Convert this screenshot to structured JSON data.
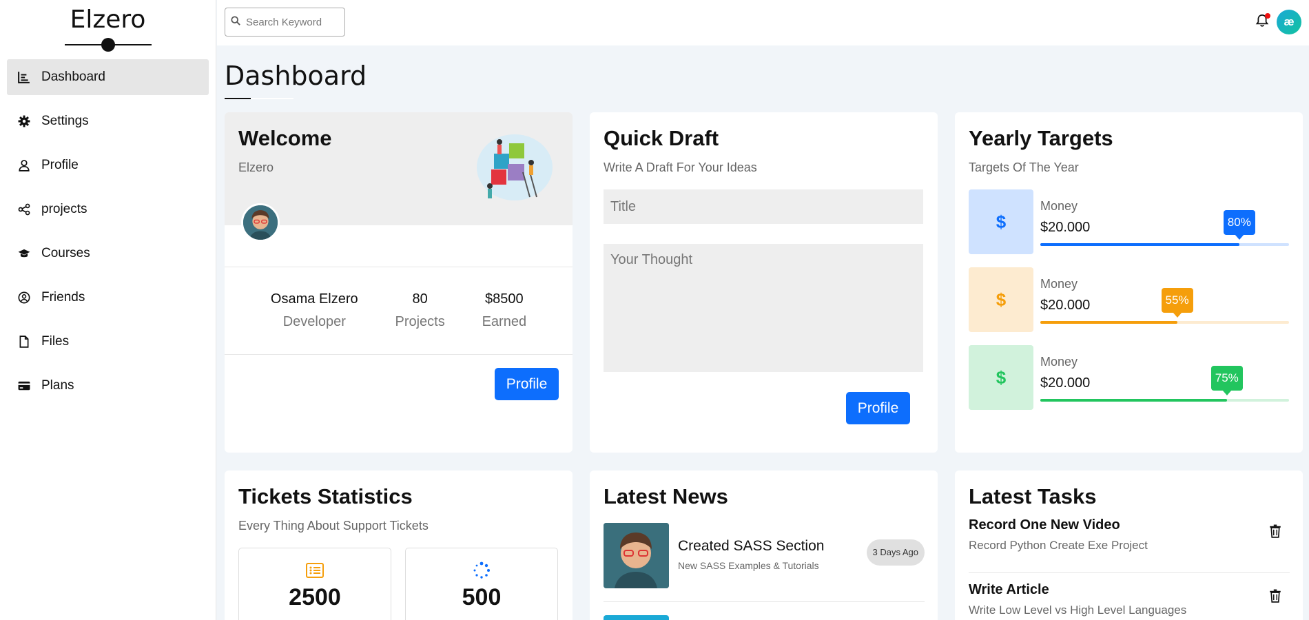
{
  "brand": {
    "title": "Elzero"
  },
  "sidebar": {
    "items": [
      {
        "label": "Dashboard",
        "icon": "chart-icon"
      },
      {
        "label": "Settings",
        "icon": "gear-icon"
      },
      {
        "label": "Profile",
        "icon": "user-icon"
      },
      {
        "label": "projects",
        "icon": "share-icon"
      },
      {
        "label": "Courses",
        "icon": "graduation-cap-icon"
      },
      {
        "label": "Friends",
        "icon": "user-circle-icon"
      },
      {
        "label": "Files",
        "icon": "file-icon"
      },
      {
        "label": "Plans",
        "icon": "credit-card-icon"
      }
    ]
  },
  "header": {
    "search_placeholder": "Search Keyword",
    "avatar_text": "æ"
  },
  "page": {
    "title": "Dashboard"
  },
  "welcome": {
    "title": "Welcome",
    "subtitle": "Elzero",
    "stats": [
      {
        "value": "Osama Elzero",
        "label": "Developer"
      },
      {
        "value": "80",
        "label": "Projects"
      },
      {
        "value": "$8500",
        "label": "Earned"
      }
    ],
    "button": "Profile"
  },
  "quick_draft": {
    "title": "Quick Draft",
    "subtitle": "Write A Draft For Your Ideas",
    "title_placeholder": "Title",
    "body_placeholder": "Your Thought",
    "button": "Profile"
  },
  "targets": {
    "title": "Yearly Targets",
    "subtitle": "Targets Of The Year",
    "items": [
      {
        "icon": "$",
        "label": "Money",
        "amount": "$20.000",
        "percent": 80,
        "percent_label": "80%",
        "color": "#0d6efd",
        "bg": "#cfe2ff",
        "track": "#cfe2ff"
      },
      {
        "icon": "$",
        "label": "Money",
        "amount": "$20.000",
        "percent": 55,
        "percent_label": "55%",
        "color": "#f59e0b",
        "bg": "#fdebd0",
        "track": "#fdebd0"
      },
      {
        "icon": "$",
        "label": "Money",
        "amount": "$20.000",
        "percent": 75,
        "percent_label": "75%",
        "color": "#22c55e",
        "bg": "#d1f2dc",
        "track": "#d1f2dc"
      }
    ]
  },
  "tickets": {
    "title": "Tickets Statistics",
    "subtitle": "Every Thing About Support Tickets",
    "boxes": [
      {
        "icon": "list-icon",
        "value": "2500",
        "color": "#f59e0b"
      },
      {
        "icon": "spinner-icon",
        "value": "500",
        "color": "#0d6efd"
      }
    ]
  },
  "news": {
    "title": "Latest News",
    "items": [
      {
        "title": "Created SASS Section",
        "desc": "New SASS Examples & Tutorials",
        "badge": "3 Days Ago"
      }
    ]
  },
  "tasks": {
    "title": "Latest Tasks",
    "items": [
      {
        "title": "Record One New Video",
        "desc": "Record Python Create Exe Project"
      },
      {
        "title": "Write Article",
        "desc": "Write Low Level vs High Level Languages"
      }
    ]
  }
}
